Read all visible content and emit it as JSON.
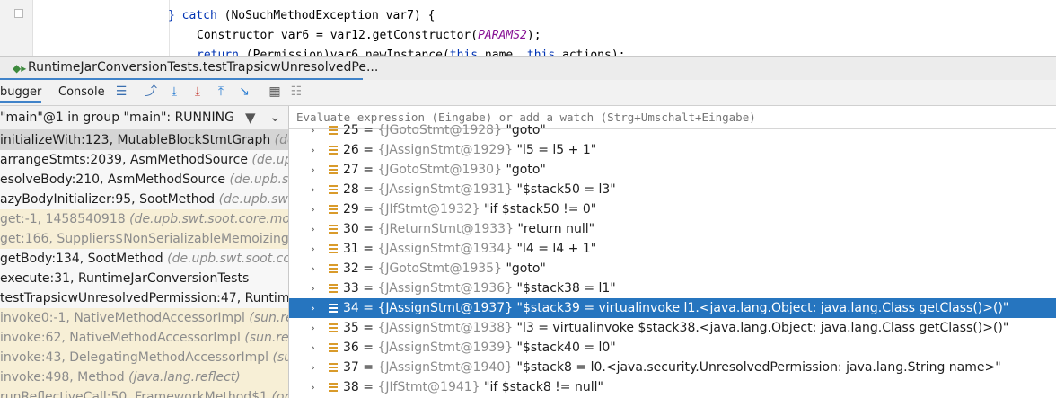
{
  "editor": {
    "line_catch_kw": "} catch",
    "line_catch_rest": " (NoSuchMethodException var7) {",
    "line_ctor_a": "Constructor var6 = var12.getConstructor(",
    "line_ctor_param": "PARAMS2",
    "line_ctor_b": ");",
    "line_return_kw": "return",
    "line_return_rest": " (Permission)var6.newInstance(",
    "line_return_this1": "this",
    "line_return_mid": ".name, ",
    "line_return_this2": "this",
    "line_return_end": ".actions);"
  },
  "run_tab": {
    "title": "RuntimeJarConversionTests.testTrapsicwUnresolvedPe..."
  },
  "toolbar": {
    "debugger_label": "bugger",
    "console_label": "Console",
    "icons": [
      "list-icon",
      "show-execution-point-icon",
      "step-over-icon",
      "step-into-icon",
      "force-step-into-icon",
      "step-out-icon",
      "run-to-cursor-icon",
      "evaluate-icon",
      "trace-icon"
    ]
  },
  "frames": {
    "thread_label": "\"main\"@1 in group \"main\": RUNNING",
    "items": [
      {
        "method": "initializeWith:123, MutableBlockStmtGraph ",
        "pkg": "(de.u"
      },
      {
        "method": "arrangeStmts:2039, AsmMethodSource ",
        "pkg": "(de.upb.s"
      },
      {
        "method": "esolveBody:210, AsmMethodSource ",
        "pkg": "(de.upb.sw"
      },
      {
        "method": "azyBodyInitializer:95, SootMethod ",
        "pkg": "(de.upb.swt."
      },
      {
        "method": "get:-1, 1458540918 ",
        "pkg": "(de.upb.swt.soot.core.model.S"
      },
      {
        "method": "get:166, Suppliers$NonSerializableMemoizingSu",
        "pkg": ""
      },
      {
        "method": "getBody:134, SootMethod ",
        "pkg": "(de.upb.swt.soot.core"
      },
      {
        "method": "execute:31, RuntimeJarConversionTests ",
        "pkg": ""
      },
      {
        "method": "testTrapsicwUnresolvedPermission:47, Runtime",
        "pkg": ""
      },
      {
        "method": "invoke0:-1, NativeMethodAccessorImpl ",
        "pkg": "(sun.refl"
      },
      {
        "method": "invoke:62, NativeMethodAccessorImpl ",
        "pkg": "(sun.refle"
      },
      {
        "method": "invoke:43, DelegatingMethodAccessorImpl ",
        "pkg": "(sun"
      },
      {
        "method": "invoke:498, Method ",
        "pkg": "(java.lang.reflect)"
      },
      {
        "method": "runReflectiveCall:50, FrameworkMethod$1 ",
        "pkg": "(org.ju"
      }
    ]
  },
  "watch": {
    "placeholder": "Evaluate expression (Eingabe) or add a watch (Strg+Umschalt+Eingabe)"
  },
  "variables": {
    "items": [
      {
        "index": "25 = ",
        "type": "{JGotoStmt@1928} ",
        "value": "\"goto\""
      },
      {
        "index": "26 = ",
        "type": "{JAssignStmt@1929} ",
        "value": "\"l5 = l5 + 1\""
      },
      {
        "index": "27 = ",
        "type": "{JGotoStmt@1930} ",
        "value": "\"goto\""
      },
      {
        "index": "28 = ",
        "type": "{JAssignStmt@1931} ",
        "value": "\"$stack50 = l3\""
      },
      {
        "index": "29 = ",
        "type": "{JIfStmt@1932} ",
        "value": "\"if $stack50 != 0\""
      },
      {
        "index": "30 = ",
        "type": "{JReturnStmt@1933} ",
        "value": "\"return null\""
      },
      {
        "index": "31 = ",
        "type": "{JAssignStmt@1934} ",
        "value": "\"l4 = l4 + 1\""
      },
      {
        "index": "32 = ",
        "type": "{JGotoStmt@1935} ",
        "value": "\"goto\""
      },
      {
        "index": "33 = ",
        "type": "{JAssignStmt@1936} ",
        "value": "\"$stack38 = l1\""
      },
      {
        "index": "34 = ",
        "type": "{JAssignStmt@1937} ",
        "value": "\"$stack39 = virtualinvoke l1.<java.lang.Object: java.lang.Class getClass()>()\""
      },
      {
        "index": "35 = ",
        "type": "{JAssignStmt@1938} ",
        "value": "\"l3 = virtualinvoke $stack38.<java.lang.Object: java.lang.Class getClass()>()\""
      },
      {
        "index": "36 = ",
        "type": "{JAssignStmt@1939} ",
        "value": "\"$stack40 = l0\""
      },
      {
        "index": "37 = ",
        "type": "{JAssignStmt@1940} ",
        "value": "\"$stack8 = l0.<java.security.UnresolvedPermission: java.lang.String name>\""
      },
      {
        "index": "38 = ",
        "type": "{JIfStmt@1941} ",
        "value": "\"if $stack8 != null\""
      }
    ]
  },
  "colors": {
    "selection": "#2675bf",
    "tab_accent": "#4083c9",
    "active_frame": "#d5d5d5",
    "library_frame": "#f7efd6"
  }
}
